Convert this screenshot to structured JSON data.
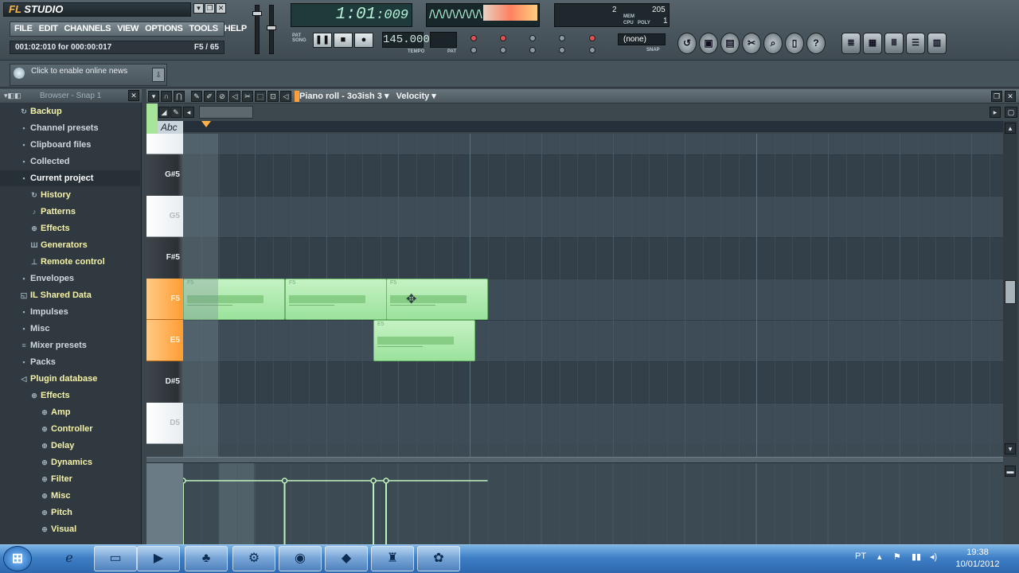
{
  "app": {
    "title": "FL STUDIO",
    "title_prefix": "FL",
    "title_suffix": "STUDIO"
  },
  "menu": [
    "FILE",
    "EDIT",
    "CHANNELS",
    "VIEW",
    "OPTIONS",
    "TOOLS",
    "HELP"
  ],
  "hint": {
    "left": "001:02:010 for 000:00:017",
    "right": "F5 / 65"
  },
  "transport": {
    "time_main": "1:01",
    "time_small": ":009",
    "tempo": "145.000",
    "tempo_label": "TEMPO",
    "pat_label": "PAT",
    "pause_icon": "pause-icon",
    "stop_icon": "stop-icon",
    "record_icon": "record-icon"
  },
  "scope": {
    "wave": "/\\/\\/\\/\\/\\/\\/\\/\\"
  },
  "cpu": {
    "value1": "2",
    "value2": "205",
    "mem_label": "MEM",
    "cpu_label": "CPU",
    "poly_label": "POLY",
    "poly_value": "1"
  },
  "snap": {
    "value": "(none)",
    "label": "SNAP"
  },
  "news": {
    "text": "Click to enable online news"
  },
  "browser": {
    "title": "Browser - Snap 1",
    "items": [
      {
        "label": "Backup",
        "indent": 0,
        "color": "cy",
        "icon": "↻"
      },
      {
        "label": "Channel presets",
        "indent": 0,
        "color": "c1",
        "icon": "▪"
      },
      {
        "label": "Clipboard files",
        "indent": 0,
        "color": "c1",
        "icon": "▪"
      },
      {
        "label": "Collected",
        "indent": 0,
        "color": "c1",
        "icon": "▪"
      },
      {
        "label": "Current project",
        "indent": 0,
        "color": "cw",
        "icon": "▪"
      },
      {
        "label": "History",
        "indent": 1,
        "color": "cy",
        "icon": "↻"
      },
      {
        "label": "Patterns",
        "indent": 1,
        "color": "cy",
        "icon": "♪"
      },
      {
        "label": "Effects",
        "indent": 1,
        "color": "cy",
        "icon": "⊕"
      },
      {
        "label": "Generators",
        "indent": 1,
        "color": "cy",
        "icon": "Ш"
      },
      {
        "label": "Remote control",
        "indent": 1,
        "color": "cy",
        "icon": "⊥"
      },
      {
        "label": "Envelopes",
        "indent": 0,
        "color": "c1",
        "icon": "▪"
      },
      {
        "label": "IL Shared Data",
        "indent": 0,
        "color": "cy",
        "icon": "◱"
      },
      {
        "label": "Impulses",
        "indent": 0,
        "color": "c1",
        "icon": "▪"
      },
      {
        "label": "Misc",
        "indent": 0,
        "color": "c1",
        "icon": "▪"
      },
      {
        "label": "Mixer presets",
        "indent": 0,
        "color": "c1",
        "icon": "≡"
      },
      {
        "label": "Packs",
        "indent": 0,
        "color": "c1",
        "icon": "▪"
      },
      {
        "label": "Plugin database",
        "indent": 0,
        "color": "cy",
        "icon": "◁"
      },
      {
        "label": "Effects",
        "indent": 1,
        "color": "cy",
        "icon": "⊕"
      },
      {
        "label": "Amp",
        "indent": 2,
        "color": "cy",
        "icon": "⊕"
      },
      {
        "label": "Controller",
        "indent": 2,
        "color": "cy",
        "icon": "⊕"
      },
      {
        "label": "Delay",
        "indent": 2,
        "color": "cy",
        "icon": "⊕"
      },
      {
        "label": "Dynamics",
        "indent": 2,
        "color": "cy",
        "icon": "⊕"
      },
      {
        "label": "Filter",
        "indent": 2,
        "color": "cy",
        "icon": "⊕"
      },
      {
        "label": "Misc",
        "indent": 2,
        "color": "cy",
        "icon": "⊕"
      },
      {
        "label": "Pitch",
        "indent": 2,
        "color": "cy",
        "icon": "⊕"
      },
      {
        "label": "Visual",
        "indent": 2,
        "color": "cy",
        "icon": "⊕"
      }
    ]
  },
  "pianoroll": {
    "title": "Piano roll - 3o3ish 3",
    "target": "Velocity",
    "abc_label": "Abc"
  },
  "keys": [
    {
      "label": "",
      "type": "white"
    },
    {
      "label": "G#5",
      "type": "black"
    },
    {
      "label": "G5",
      "type": "white"
    },
    {
      "label": "F#5",
      "type": "black"
    },
    {
      "label": "F5",
      "type": "orange"
    },
    {
      "label": "E5",
      "type": "orange"
    },
    {
      "label": "D#5",
      "type": "black"
    },
    {
      "label": "D5",
      "type": "white"
    }
  ],
  "notes": [
    {
      "pitch": "F5",
      "start": 0,
      "length": 1
    },
    {
      "pitch": "F5",
      "start": 1,
      "length": 1
    },
    {
      "pitch": "F5",
      "start": 2,
      "length": 1
    },
    {
      "pitch": "E5",
      "start": 1.875,
      "length": 1
    }
  ],
  "taskbar": {
    "lang": "PT",
    "time": "19:38",
    "date": "10/01/2012",
    "apps": [
      "ie-icon",
      "explorer-icon",
      "media-player-icon",
      "games-icon",
      "steam-icon",
      "chrome-icon",
      "app-icon",
      "gamepad-icon",
      "fl-studio-icon"
    ]
  },
  "colors": {
    "note_fill": "#a8e6a6",
    "accent_orange": "#ff9d36",
    "grid_bg": "#3c4a54"
  }
}
